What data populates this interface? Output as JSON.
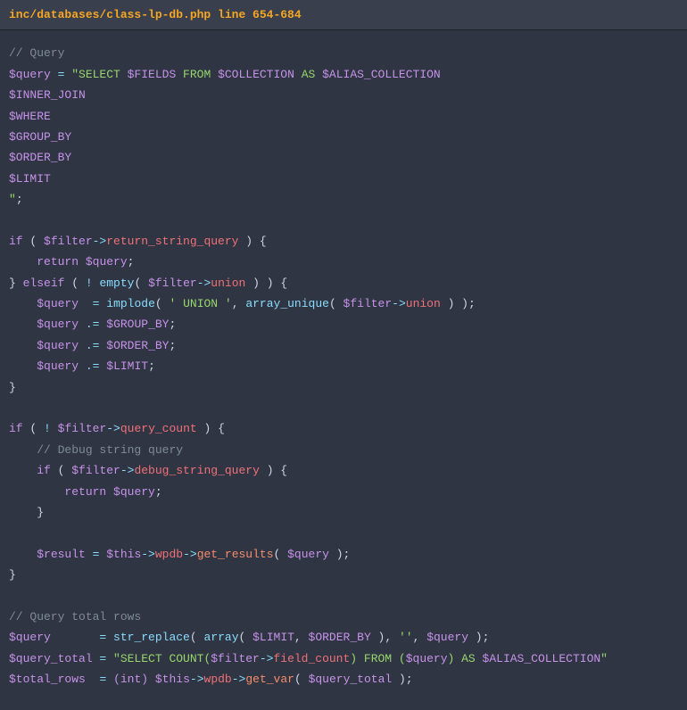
{
  "header": {
    "title": "inc/databases/class-lp-db.php line 654-684"
  },
  "code": {
    "l1_comment": "// Query",
    "l2_var": "$query",
    "l2_op": " = ",
    "l2_str": "\"SELECT ",
    "l2_v1": "$FIELDS",
    "l2_s2": " FROM ",
    "l2_v2": "$COLLECTION",
    "l2_s3": " AS ",
    "l2_v3": "$ALIAS_COLLECTION",
    "l3_v": "$INNER_JOIN",
    "l4_v": "$WHERE",
    "l5_v": "$GROUP_BY",
    "l6_v": "$ORDER_BY",
    "l7_v": "$LIMIT",
    "l8_strend": "\"",
    "l8_semi": ";",
    "l10_if": "if",
    "l10_p1": " ( ",
    "l10_var": "$filter",
    "l10_arr": "->",
    "l10_prop": "return_string_query",
    "l10_p2": " ) {",
    "l11_ind": "    ",
    "l11_ret": "return",
    "l11_sp": " ",
    "l11_var": "$query",
    "l11_semi": ";",
    "l12_cl": "} ",
    "l12_elif": "elseif",
    "l12_p1": " ( ",
    "l12_not": "!",
    "l12_sp": " ",
    "l12_fn": "empty",
    "l12_p2": "( ",
    "l12_var": "$filter",
    "l12_arr": "->",
    "l12_prop": "union",
    "l12_p3": " ) ) {",
    "l13_ind": "    ",
    "l13_var": "$query",
    "l13_sp": "  ",
    "l13_op": "=",
    "l13_sp2": " ",
    "l13_fn": "implode",
    "l13_p1": "( ",
    "l13_str": "' UNION '",
    "l13_c": ", ",
    "l13_fn2": "array_unique",
    "l13_p2": "( ",
    "l13_var2": "$filter",
    "l13_arr": "->",
    "l13_prop": "union",
    "l13_p3": " ) );",
    "l14_ind": "    ",
    "l14_var": "$query",
    "l14_sp": " ",
    "l14_op": ".=",
    "l14_sp2": " ",
    "l14_v2": "$GROUP_BY",
    "l14_semi": ";",
    "l15_ind": "    ",
    "l15_var": "$query",
    "l15_sp": " ",
    "l15_op": ".=",
    "l15_sp2": " ",
    "l15_v2": "$ORDER_BY",
    "l15_semi": ";",
    "l16_ind": "    ",
    "l16_var": "$query",
    "l16_sp": " ",
    "l16_op": ".=",
    "l16_sp2": " ",
    "l16_v2": "$LIMIT",
    "l16_semi": ";",
    "l17_cl": "}",
    "l19_if": "if",
    "l19_p1": " ( ",
    "l19_not": "!",
    "l19_sp": " ",
    "l19_var": "$filter",
    "l19_arr": "->",
    "l19_prop": "query_count",
    "l19_p2": " ) {",
    "l20_ind": "    ",
    "l20_comment": "// Debug string query",
    "l21_ind": "    ",
    "l21_if": "if",
    "l21_p1": " ( ",
    "l21_var": "$filter",
    "l21_arr": "->",
    "l21_prop": "debug_string_query",
    "l21_p2": " ) {",
    "l22_ind": "        ",
    "l22_ret": "return",
    "l22_sp": " ",
    "l22_var": "$query",
    "l22_semi": ";",
    "l23_ind": "    ",
    "l23_cl": "}",
    "l25_ind": "    ",
    "l25_var": "$result",
    "l25_op": " = ",
    "l25_this": "$this",
    "l25_arr1": "->",
    "l25_p1": "wpdb",
    "l25_arr2": "->",
    "l25_fn": "get_results",
    "l25_p2": "( ",
    "l25_var2": "$query",
    "l25_p3": " );",
    "l26_cl": "}",
    "l28_comment": "// Query total rows",
    "l29_var": "$query",
    "l29_sp": "       ",
    "l29_op": "=",
    "l29_sp2": " ",
    "l29_fn": "str_replace",
    "l29_p1": "( ",
    "l29_fn2": "array",
    "l29_p2": "( ",
    "l29_v1": "$LIMIT",
    "l29_c1": ", ",
    "l29_v2": "$ORDER_BY",
    "l29_p3": " ), ",
    "l29_str": "''",
    "l29_c2": ", ",
    "l29_v3": "$query",
    "l29_p4": " );",
    "l30_var": "$query_total",
    "l30_op": " = ",
    "l30_s1": "\"SELECT COUNT(",
    "l30_v1": "$filter",
    "l30_arr": "->",
    "l30_prop": "field_count",
    "l30_s2": ") FROM (",
    "l30_v2": "$query",
    "l30_s3": ") AS ",
    "l30_v3": "$ALIAS_COLLECTION",
    "l30_s4": "\"",
    "l31_var": "$total_rows",
    "l31_sp": "  ",
    "l31_op": "=",
    "l31_sp2": " ",
    "l31_cast": "(int)",
    "l31_sp3": " ",
    "l31_this": "$this",
    "l31_arr1": "->",
    "l31_p1": "wpdb",
    "l31_arr2": "->",
    "l31_fn": "get_var",
    "l31_p2": "( ",
    "l31_v2": "$query_total",
    "l31_p3": " );"
  }
}
